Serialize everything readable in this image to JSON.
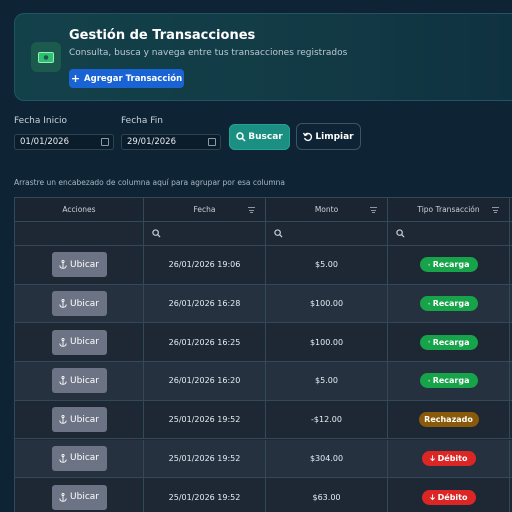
{
  "header": {
    "title": "Gestión de Transacciones",
    "subtitle": "Consulta, busca y navega entre tus transacciones registrados",
    "add_button": "Agregar Transacción"
  },
  "filters": {
    "start_label": "Fecha Inicio",
    "start_value": "01/01/2026",
    "end_label": "Fecha Fin",
    "end_value": "29/01/2026",
    "search_button": "Buscar",
    "clear_button": "Limpiar"
  },
  "grid": {
    "group_hint": "Arrastre un encabezado de columna aquí para agrupar por esa columna",
    "columns": [
      "Acciones",
      "Fecha",
      "Monto",
      "Tipo Transacción"
    ],
    "action_label": "Ubicar",
    "rows": [
      {
        "fecha": "26/01/2026 19:06",
        "monto": "$5.00",
        "tipo": "Recarga",
        "kind": "recarga"
      },
      {
        "fecha": "26/01/2026 16:28",
        "monto": "$100.00",
        "tipo": "Recarga",
        "kind": "recarga"
      },
      {
        "fecha": "26/01/2026 16:25",
        "monto": "$100.00",
        "tipo": "Recarga",
        "kind": "recarga"
      },
      {
        "fecha": "26/01/2026 16:20",
        "monto": "$5.00",
        "tipo": "Recarga",
        "kind": "recarga"
      },
      {
        "fecha": "25/01/2026 19:52",
        "monto": "-$12.00",
        "tipo": "Rechazado",
        "kind": "rechazado"
      },
      {
        "fecha": "25/01/2026 19:52",
        "monto": "$304.00",
        "tipo": "Débito",
        "kind": "debito"
      },
      {
        "fecha": "25/01/2026 19:52",
        "monto": "$63.00",
        "tipo": "Débito",
        "kind": "debito"
      }
    ]
  },
  "colors": {
    "background": "#0e2334",
    "primary_button": "#1a63d4",
    "search_button": "#1a8f82",
    "recarga": "#16a34a",
    "rechazado": "#8a5a0b",
    "debito": "#dc2626"
  }
}
